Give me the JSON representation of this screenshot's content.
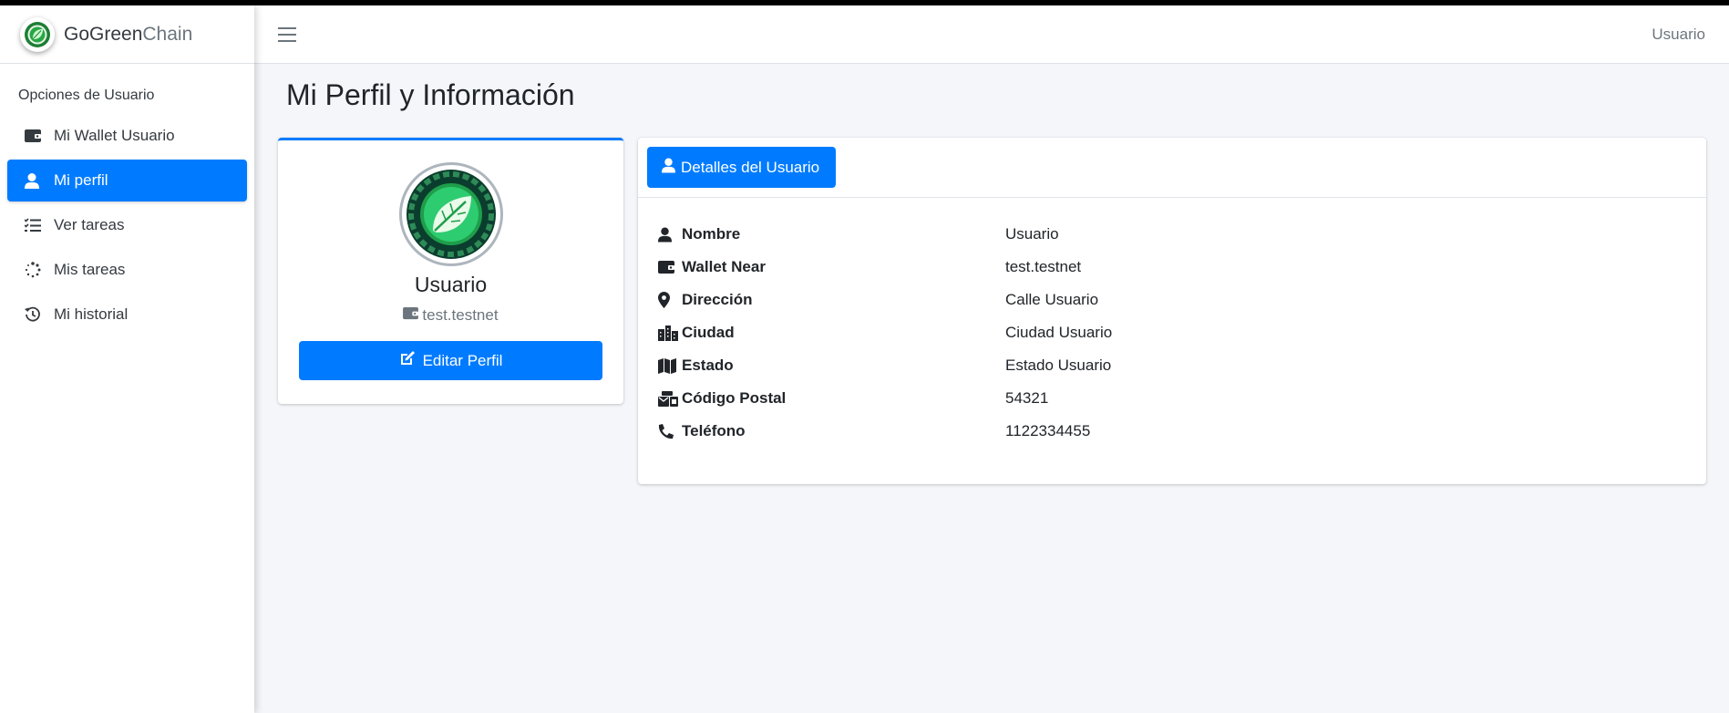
{
  "brand": {
    "name_bold": "GoGreen",
    "name_light": "Chain",
    "logo_icon": "leaf-chain-logo-icon"
  },
  "sidebar": {
    "header": "Opciones de Usuario",
    "items": [
      {
        "label": "Mi Wallet Usuario",
        "icon": "wallet-icon",
        "active": false
      },
      {
        "label": "Mi perfil",
        "icon": "user-icon",
        "active": true
      },
      {
        "label": "Ver tareas",
        "icon": "task-list-icon",
        "active": false
      },
      {
        "label": "Mis tareas",
        "icon": "spinner-icon",
        "active": false
      },
      {
        "label": "Mi historial",
        "icon": "history-icon",
        "active": false
      }
    ]
  },
  "navbar": {
    "user": "Usuario",
    "menu_icon": "hamburger-icon"
  },
  "page": {
    "title": "Mi Perfil y Información"
  },
  "profile": {
    "name": "Usuario",
    "wallet": "test.testnet",
    "edit_button": "Editar Perfil"
  },
  "details": {
    "header_button": "Detalles del Usuario",
    "rows": [
      {
        "label": "Nombre",
        "value": "Usuario",
        "icon": "user-icon"
      },
      {
        "label": "Wallet Near",
        "value": "test.testnet",
        "icon": "wallet-icon"
      },
      {
        "label": "Dirección",
        "value": "Calle Usuario",
        "icon": "map-marker-icon"
      },
      {
        "label": "Ciudad",
        "value": "Ciudad Usuario",
        "icon": "city-icon"
      },
      {
        "label": "Estado",
        "value": "Estado Usuario",
        "icon": "map-icon"
      },
      {
        "label": "Código Postal",
        "value": "54321",
        "icon": "mail-bulk-icon"
      },
      {
        "label": "Teléfono",
        "value": "1122334455",
        "icon": "phone-icon"
      }
    ]
  },
  "colors": {
    "primary": "#007bff",
    "background": "#f4f6f9",
    "sidebar_bg": "#ffffff",
    "text_dark": "#212529",
    "text_muted": "#6c757d"
  }
}
